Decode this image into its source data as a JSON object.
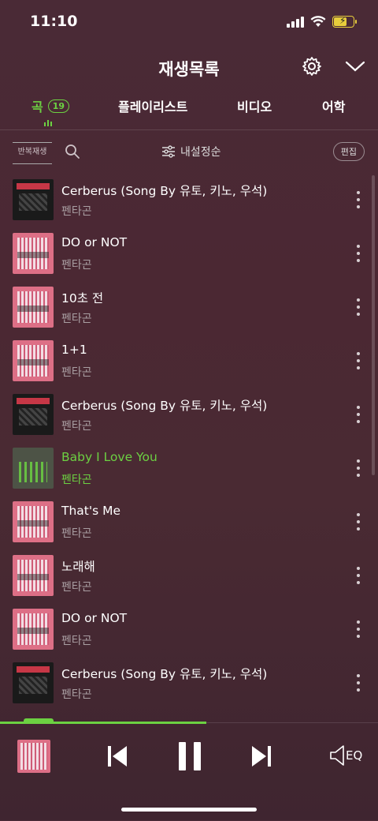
{
  "status_bar": {
    "time": "11:10",
    "battery_icon": "battery-charging-icon",
    "wifi_icon": "wifi-icon",
    "signal_icon": "cellular-signal-icon"
  },
  "header": {
    "title": "재생목록",
    "settings_icon": "gear-icon",
    "collapse_icon": "chevron-down-icon"
  },
  "tabs": [
    {
      "label": "곡",
      "count": "19",
      "active": true
    },
    {
      "label": "플레이리스트"
    },
    {
      "label": "비디오"
    },
    {
      "label": "어학"
    }
  ],
  "toolbar": {
    "repeat_label": "반복재생",
    "sort_label": "내설정순",
    "edit_label": "편집"
  },
  "songs": [
    {
      "title": "Cerberus (Song By 유토, 키노, 우석)",
      "artist": "펜타곤",
      "art": "dark"
    },
    {
      "title": "DO or NOT",
      "artist": "펜타곤",
      "art": "pink"
    },
    {
      "title": "10초 전",
      "artist": "펜타곤",
      "art": "pink"
    },
    {
      "title": "1+1",
      "artist": "펜타곤",
      "art": "pink"
    },
    {
      "title": "Cerberus (Song By 유토, 키노, 우석)",
      "artist": "펜타곤",
      "art": "dark"
    },
    {
      "title": "Baby I Love You",
      "artist": "펜타곤",
      "art": "playing",
      "now_playing": true
    },
    {
      "title": "That's Me",
      "artist": "펜타곤",
      "art": "pink"
    },
    {
      "title": "노래해",
      "artist": "펜타곤",
      "art": "pink"
    },
    {
      "title": "DO or NOT",
      "artist": "펜타곤",
      "art": "pink"
    },
    {
      "title": "Cerberus (Song By 유토, 키노, 우석)",
      "artist": "펜타곤",
      "art": "dark"
    }
  ],
  "player": {
    "eq_label": "EQ",
    "progress_fraction": 0.55
  },
  "colors": {
    "accent": "#6cd142",
    "background": "#4a2a36"
  }
}
